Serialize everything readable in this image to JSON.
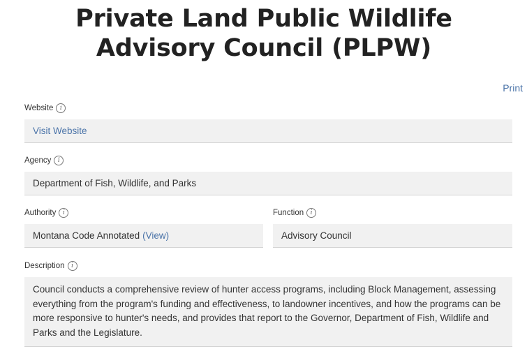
{
  "page": {
    "title": "Private Land Public Wildlife Advisory Council (PLPW)",
    "print_label": "Print"
  },
  "fields": {
    "website": {
      "label": "Website",
      "link_text": "Visit Website"
    },
    "agency": {
      "label": "Agency",
      "value": "Department of Fish, Wildlife, and Parks"
    },
    "authority": {
      "label": "Authority",
      "value": "Montana Code Annotated",
      "link_text": "(View)"
    },
    "function": {
      "label": "Function",
      "value": "Advisory Council"
    },
    "description": {
      "label": "Description",
      "value": "Council conducts a comprehensive review of hunter access programs, including Block Management, assessing everything from the program's funding and effectiveness, to landowner incentives, and how the programs can be more responsive to hunter's needs, and provides that report to the Governor, Department of Fish, Wildlife and Parks and the Legislature."
    }
  },
  "icons": {
    "info": "info-circle-icon",
    "info_glyph": "i"
  },
  "colors": {
    "link": "#4a73a8",
    "field_background": "#f1f1f1",
    "title_text": "#222222"
  }
}
